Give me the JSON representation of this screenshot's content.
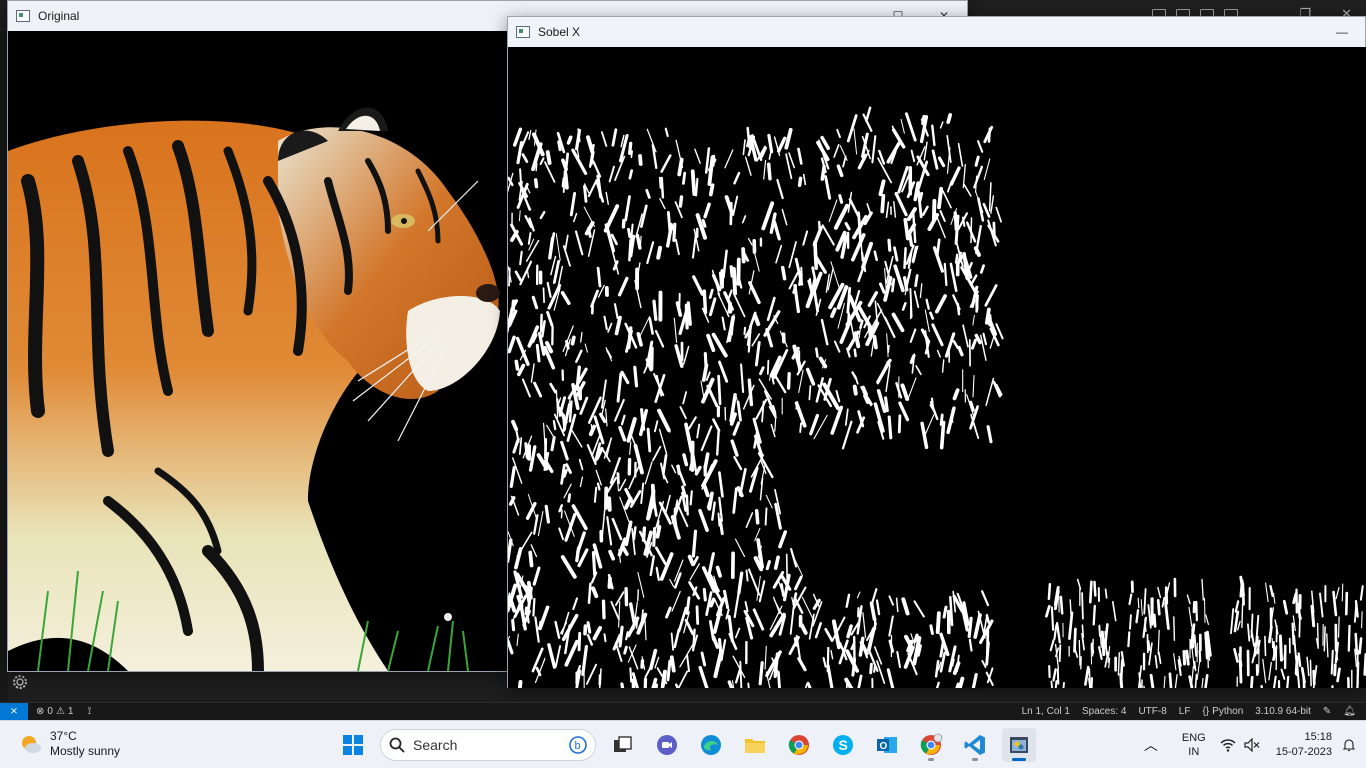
{
  "editor": {
    "status": {
      "problems": "0",
      "warnings": "1",
      "position": "Ln 1, Col 1",
      "spaces": "Spaces: 4",
      "encoding": "UTF-8",
      "eol": "LF",
      "language": "Python",
      "interpreter": "3.10.9 64-bit"
    }
  },
  "windows": {
    "original": {
      "title": "Original"
    },
    "sobel": {
      "title": "Sobel X"
    }
  },
  "taskbar": {
    "weather": {
      "temp": "37°C",
      "condition": "Mostly sunny"
    },
    "search_placeholder": "Search",
    "apps": [
      "start",
      "search",
      "task-view",
      "meet",
      "edge",
      "file-explorer",
      "chrome",
      "skype",
      "outlook",
      "chrome-profile",
      "vscode",
      "python"
    ],
    "lang_top": "ENG",
    "lang_bottom": "IN",
    "time": "15:18",
    "date": "15-07-2023"
  },
  "colors": {
    "accent": "#0078d4",
    "taskbar": "#eef1f7",
    "status_remote": "#0078d4"
  }
}
